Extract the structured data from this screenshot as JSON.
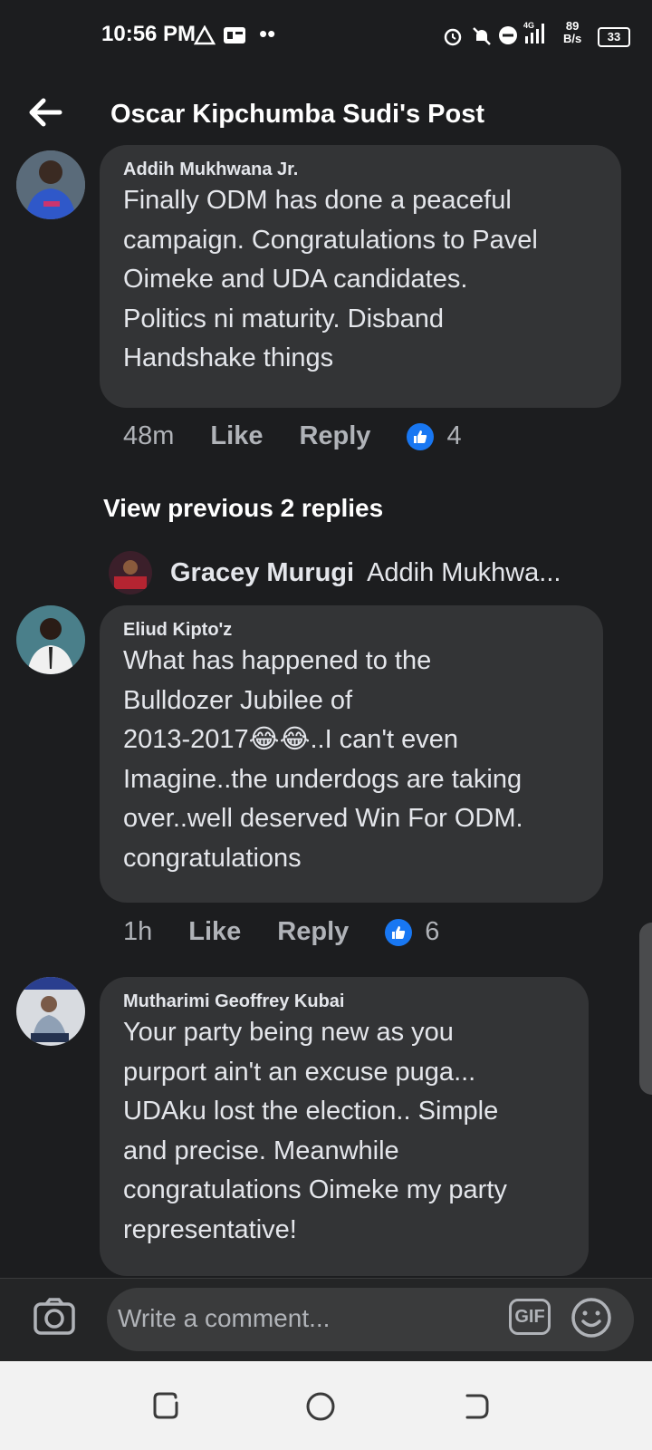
{
  "status_bar": {
    "time": "10:56 PM",
    "net_speed_value": "89",
    "net_speed_unit": "B/s",
    "network_label": "4G",
    "battery": "33"
  },
  "header": {
    "title": "Oscar Kipchumba Sudi's Post"
  },
  "comments": [
    {
      "author": "Addih Mukhwana Jr.",
      "text": "Finally ODM has done a peaceful\ncampaign. Congratulations to Pavel\nOimeke and UDA candidates.\nPolitics ni maturity. Disband\nHandshake things",
      "time": "48m",
      "like_label": "Like",
      "reply_label": "Reply",
      "reaction_count": "4"
    },
    {
      "author": "Eliud Kipto'z",
      "text": "What has happened to the\nBulldozer Jubilee of\n2013-2017😂😂..I can't even\nImagine..the underdogs are taking\nover..well deserved Win For ODM.\ncongratulations",
      "time": "1h",
      "like_label": "Like",
      "reply_label": "Reply",
      "reaction_count": "6"
    },
    {
      "author": "Mutharimi Geoffrey Kubai",
      "text": "Your party being new as you\npurport ain't an excuse puga...\nUDAku lost the election.. Simple\nand precise. Meanwhile\ncongratulations Oimeke my party\nrepresentative!"
    }
  ],
  "replies": {
    "view_previous": "View previous 2 replies",
    "latest_reply_author": "Gracey Murugi",
    "latest_reply_preview": "Addih Mukhwa..."
  },
  "composer": {
    "placeholder": "Write a comment...",
    "gif_label": "GIF"
  },
  "colors": {
    "background": "#1c1d1f",
    "bubble": "#333436",
    "like_blue": "#1877f2"
  }
}
